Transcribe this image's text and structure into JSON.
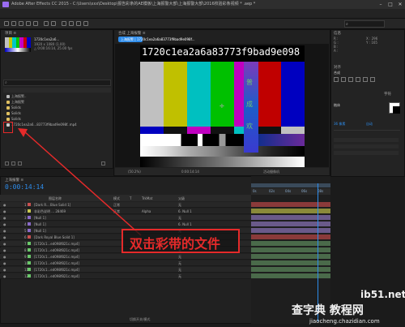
{
  "titlebar": {
    "title": "Adobe After Effects CC 2015 - C:\\Users\\xxx\\Desktop\\报告彩条的AE模板\\上海报警大部\\上海报警大部\\2016校验彩条视频 * .aep *"
  },
  "project": {
    "tab": "项目 ≡",
    "thumb_name": "1720c1ea2a6...",
    "thumb_info": "1920 x 1080 (1.00)\n△ 0:00:16:14, 25.00 fps",
    "items": [
      {
        "name": "上海报警..",
        "color": "#bbbbbb"
      },
      {
        "name": "上海报警",
        "color": "#e0c060"
      },
      {
        "name": "Solids",
        "color": "#e0c060"
      },
      {
        "name": "Solids",
        "color": "#e0c060"
      },
      {
        "name": "Solids",
        "color": "#e0c060"
      },
      {
        "name": "1720c1ea2a6...83773f9bad9e098f..mp4",
        "color": "#cccccc"
      }
    ]
  },
  "composition": {
    "tab": "合成 上海报警 ≡",
    "breadcrumb": "上海报警 | 1720c1ea2a6a83773f9bad9e098f...",
    "overlay_text": "1720c1ea2a6a83773f9bad9e098",
    "chars": [
      "普",
      "成",
      "欢"
    ],
    "zoom": "(50.2%)",
    "timecode": "0:00:14:14",
    "camera": "活动摄像机"
  },
  "effects": {
    "tab": "信息",
    "rows": [
      "R :",
      "G :",
      "B :",
      "A :",
      "X : 296",
      "Y : 165"
    ],
    "align_label": "对齐",
    "align_target": "合成",
    "char_tab": "字符",
    "font": "楷体",
    "size_label": "T",
    "px1": "36 像素",
    "px2": "自动"
  },
  "timeline": {
    "tab": "上海报警 ≡",
    "timecode": "0:00:14:14",
    "header": [
      "图层名称",
      "模式",
      "T",
      "TrkMat",
      "父级"
    ],
    "ruler": [
      "0s",
      "02s",
      "04s",
      "06s",
      "08s"
    ],
    "rows": [
      {
        "num": "1",
        "name": "[Dark R... Blue Solid 1]",
        "mode": "正常",
        "trk": "",
        "parent": "无"
      },
      {
        "num": "2",
        "name": "非彩色说明 ... 28469",
        "mode": "正常",
        "trk": "Alpha",
        "parent": "6. Null 1"
      },
      {
        "num": "3",
        "name": "[Null 1]",
        "mode": "",
        "trk": "",
        "parent": "无"
      },
      {
        "num": "4",
        "name": "[Null 1]",
        "mode": "",
        "trk": "",
        "parent": "6. Null 1"
      },
      {
        "num": "5",
        "name": "[Null 1]",
        "mode": "",
        "trk": "",
        "parent": "无"
      },
      {
        "num": "6",
        "name": "[Dark Royal Blue Solid 1]",
        "mode": "",
        "trk": "",
        "parent": "无"
      },
      {
        "num": "7",
        "name": "[1720c1...ed098f821c.mp4]",
        "mode": "",
        "trk": "",
        "parent": "无"
      },
      {
        "num": "8",
        "name": "[1720c1...ed098f821c.mp4]",
        "mode": "",
        "trk": "",
        "parent": "无"
      },
      {
        "num": "9",
        "name": "[1720c1...ed098f821c.mp4]",
        "mode": "",
        "trk": "",
        "parent": "无"
      },
      {
        "num": "10",
        "name": "[1720c1...ed098f821c.mp4]",
        "mode": "",
        "trk": "",
        "parent": "无"
      },
      {
        "num": "11",
        "name": "[1720c1...ed098f821c.mp4]",
        "mode": "",
        "trk": "",
        "parent": "无"
      },
      {
        "num": "12",
        "name": "[1720c1...ed098f821c.mp4]",
        "mode": "",
        "trk": "",
        "parent": "无"
      }
    ],
    "footer": "切换开关/模式"
  },
  "annotation": {
    "text": "双击彩带的文件"
  },
  "watermark": {
    "line1": "ib51.net",
    "line2": "查字典 教程网",
    "line3": "jiaocheng.chazidian.com"
  },
  "colors": {
    "annotation_red": "#e52a2a",
    "accent_blue": "#2d8ceb",
    "composition_bg": "#141414"
  }
}
